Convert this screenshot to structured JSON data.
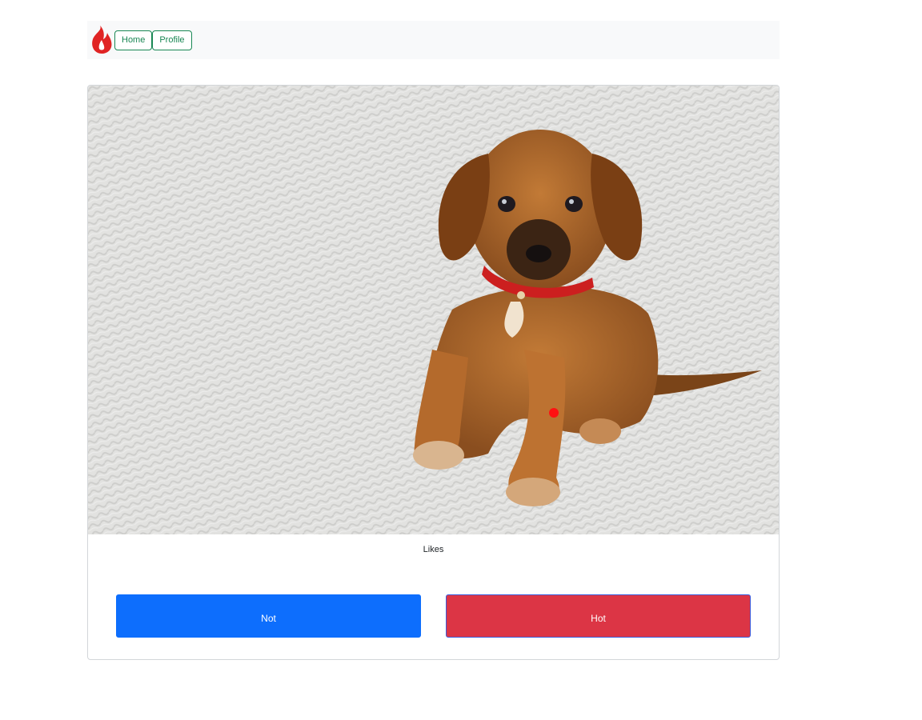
{
  "nav": {
    "logo_icon": "fire-icon",
    "home_label": "Home",
    "profile_label": "Profile",
    "accent_color": "#198754",
    "logo_color": "#e02424"
  },
  "card": {
    "image_icon": "puppy-photo",
    "likes_label": "Likes",
    "not_label": "Not",
    "hot_label": "Hot",
    "not_color": "#0d6efd",
    "hot_color": "#dc3545"
  }
}
